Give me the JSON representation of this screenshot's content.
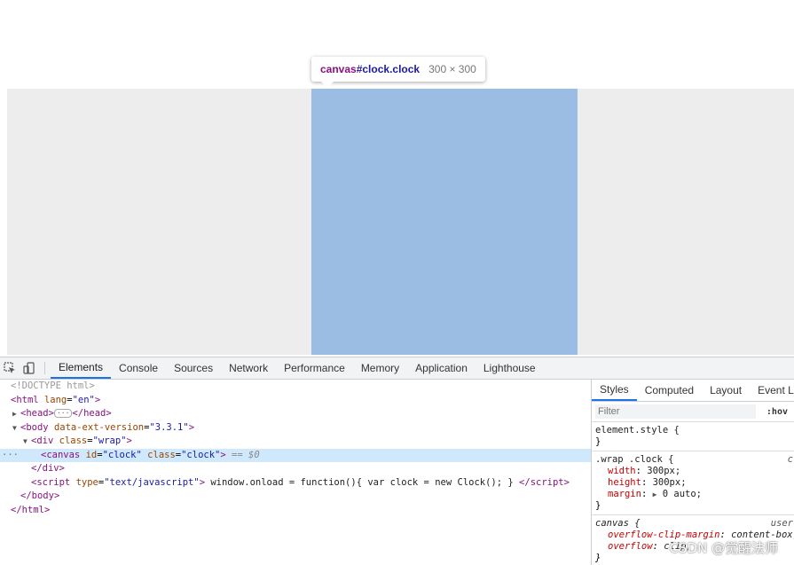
{
  "tooltip": {
    "tag": "canvas",
    "selector": "#clock.clock",
    "size": "300 × 300"
  },
  "devtools": {
    "tabs": [
      "Elements",
      "Console",
      "Sources",
      "Network",
      "Performance",
      "Memory",
      "Application",
      "Lighthouse"
    ],
    "active_tab": "Elements"
  },
  "dom": {
    "doctype": "<!DOCTYPE html>",
    "html_open_tag": "html",
    "html_attr": "lang",
    "html_val": "\"en\"",
    "head": "head",
    "body_tag": "body",
    "body_attr": "data-ext-version",
    "body_val": "\"3.3.1\"",
    "div_tag": "div",
    "div_attr": "class",
    "div_val": "\"wrap\"",
    "canvas_tag": "canvas",
    "canvas_id_attr": "id",
    "canvas_id_val": "\"clock\"",
    "canvas_class_attr": "class",
    "canvas_class_val": "\"clock\"",
    "canvas_ref": "== $0",
    "div_close": "div",
    "script_tag": "script",
    "script_attr": "type",
    "script_val": "\"text/javascript\"",
    "script_code": "window.onload = function(){ var clock = new Clock(); }",
    "body_close": "body",
    "html_close": "html"
  },
  "styles": {
    "tabs": [
      "Styles",
      "Computed",
      "Layout",
      "Event Listeners"
    ],
    "active_tab": "Styles",
    "filter_placeholder": "Filter",
    "hov": ":hov",
    "element_style": "element.style {",
    "close_brace": "}",
    "rule1": {
      "selector": ".wrap .clock {",
      "source": "c",
      "props": [
        {
          "name": "width",
          "value": "300px;"
        },
        {
          "name": "height",
          "value": "300px;"
        },
        {
          "name": "margin",
          "value": "0 auto;"
        }
      ]
    },
    "rule2": {
      "selector": "canvas {",
      "source": "user",
      "props": [
        {
          "name": "overflow-clip-margin",
          "value": "content-box;"
        },
        {
          "name": "overflow",
          "value": "clip;"
        }
      ]
    }
  },
  "watermark": "CSDN @觉醒法师"
}
